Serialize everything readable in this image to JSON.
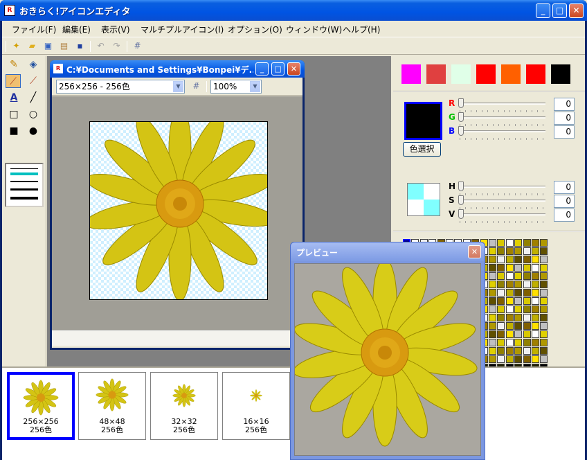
{
  "app": {
    "title": "おきらく!アイコンエディタ",
    "icon_text": "R"
  },
  "menu": [
    "ファイル(F)",
    "編集(E)",
    "表示(V)",
    "マルチプルアイコン(I)",
    "オプション(O)",
    "ウィンドウ(W)",
    "ヘルプ(H)"
  ],
  "toolbar": {
    "icons": [
      "new-file-icon",
      "open-folder-icon",
      "image-icon",
      "paste-icon",
      "save-icon",
      "undo-icon",
      "redo-icon",
      "grid-icon"
    ]
  },
  "tools": [
    "pencil",
    "fill-bucket",
    "dropper",
    "eyedropper",
    "text",
    "line",
    "rect-outline",
    "ellipse-outline",
    "rect-filled",
    "ellipse-filled"
  ],
  "child": {
    "title": "C:¥Documents and Settings¥Bonpei¥デ...",
    "size_combo": "256×256 - 256色",
    "zoom_combo": "100%"
  },
  "colors": {
    "swatches": [
      "#ff00ff",
      "#e04040",
      "#e0ffe8",
      "#ff0000",
      "#ff6000",
      "#ff0000",
      "#000000"
    ],
    "current": "#000000",
    "select_button": "色選択",
    "rgb": [
      {
        "label": "R",
        "value": "0",
        "color": "#ff0000"
      },
      {
        "label": "G",
        "value": "0",
        "color": "#00c000"
      },
      {
        "label": "B",
        "value": "0",
        "color": "#0000ff"
      }
    ],
    "hsv": [
      {
        "label": "H",
        "value": "0"
      },
      {
        "label": "S",
        "value": "0"
      },
      {
        "label": "V",
        "value": "0"
      }
    ]
  },
  "preview": {
    "title": "プレビュー"
  },
  "thumbnails": [
    {
      "size": "256×256",
      "depth": "256色"
    },
    {
      "size": "48×48",
      "depth": "256色"
    },
    {
      "size": "32×32",
      "depth": "256色"
    },
    {
      "size": "16×16",
      "depth": "256色"
    }
  ]
}
